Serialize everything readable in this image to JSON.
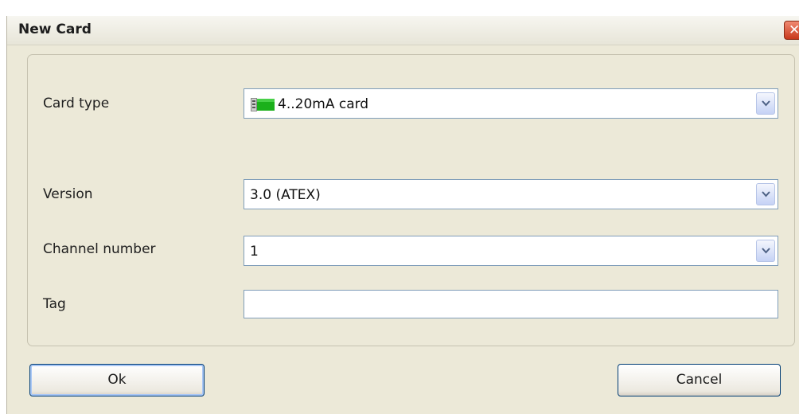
{
  "window": {
    "title": "New Card",
    "close_glyph": "✕"
  },
  "form": {
    "card_type": {
      "label": "Card type",
      "value": "4..20mA card",
      "icon": "card-icon"
    },
    "version": {
      "label": "Version",
      "value": "3.0 (ATEX)"
    },
    "channel_number": {
      "label": "Channel number",
      "value": "1"
    },
    "tag": {
      "label": "Tag",
      "value": ""
    }
  },
  "buttons": {
    "ok_label": "Ok",
    "cancel_label": "Cancel"
  },
  "colors": {
    "card_icon_green": "#1bb01b"
  }
}
